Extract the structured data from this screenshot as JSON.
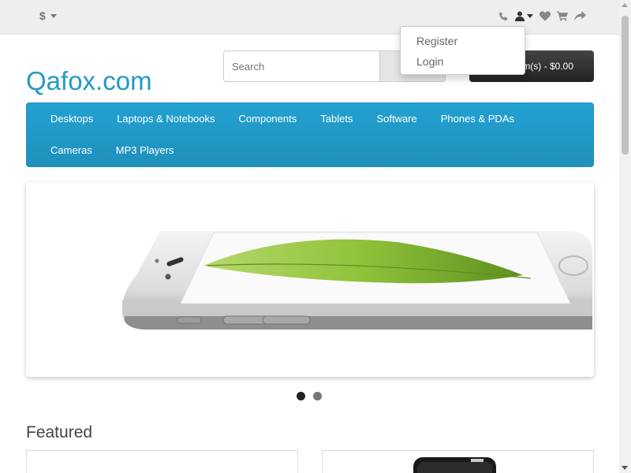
{
  "topbar": {
    "currency_symbol": "$",
    "icons": [
      "phone-icon",
      "user-icon",
      "heart-icon",
      "cart-icon",
      "share-icon"
    ]
  },
  "account_dropdown": {
    "items": [
      {
        "label": "Register"
      },
      {
        "label": "Login"
      }
    ]
  },
  "header": {
    "logo_text": "Qafox.com",
    "search_placeholder": "Search",
    "cart_label": "m(s) - $0.00"
  },
  "menu": {
    "items": [
      {
        "label": "Desktops"
      },
      {
        "label": "Laptops & Notebooks"
      },
      {
        "label": "Components"
      },
      {
        "label": "Tablets"
      },
      {
        "label": "Software"
      },
      {
        "label": "Phones & PDAs"
      },
      {
        "label": "Cameras"
      },
      {
        "label": "MP3 Players"
      }
    ]
  },
  "slideshow": {
    "slide_count": 2,
    "active_slide": 1
  },
  "featured": {
    "title": "Featured"
  },
  "colors": {
    "brand": "#229ac8",
    "menu_bg": "#229ac8",
    "cart_bg": "#303030"
  }
}
